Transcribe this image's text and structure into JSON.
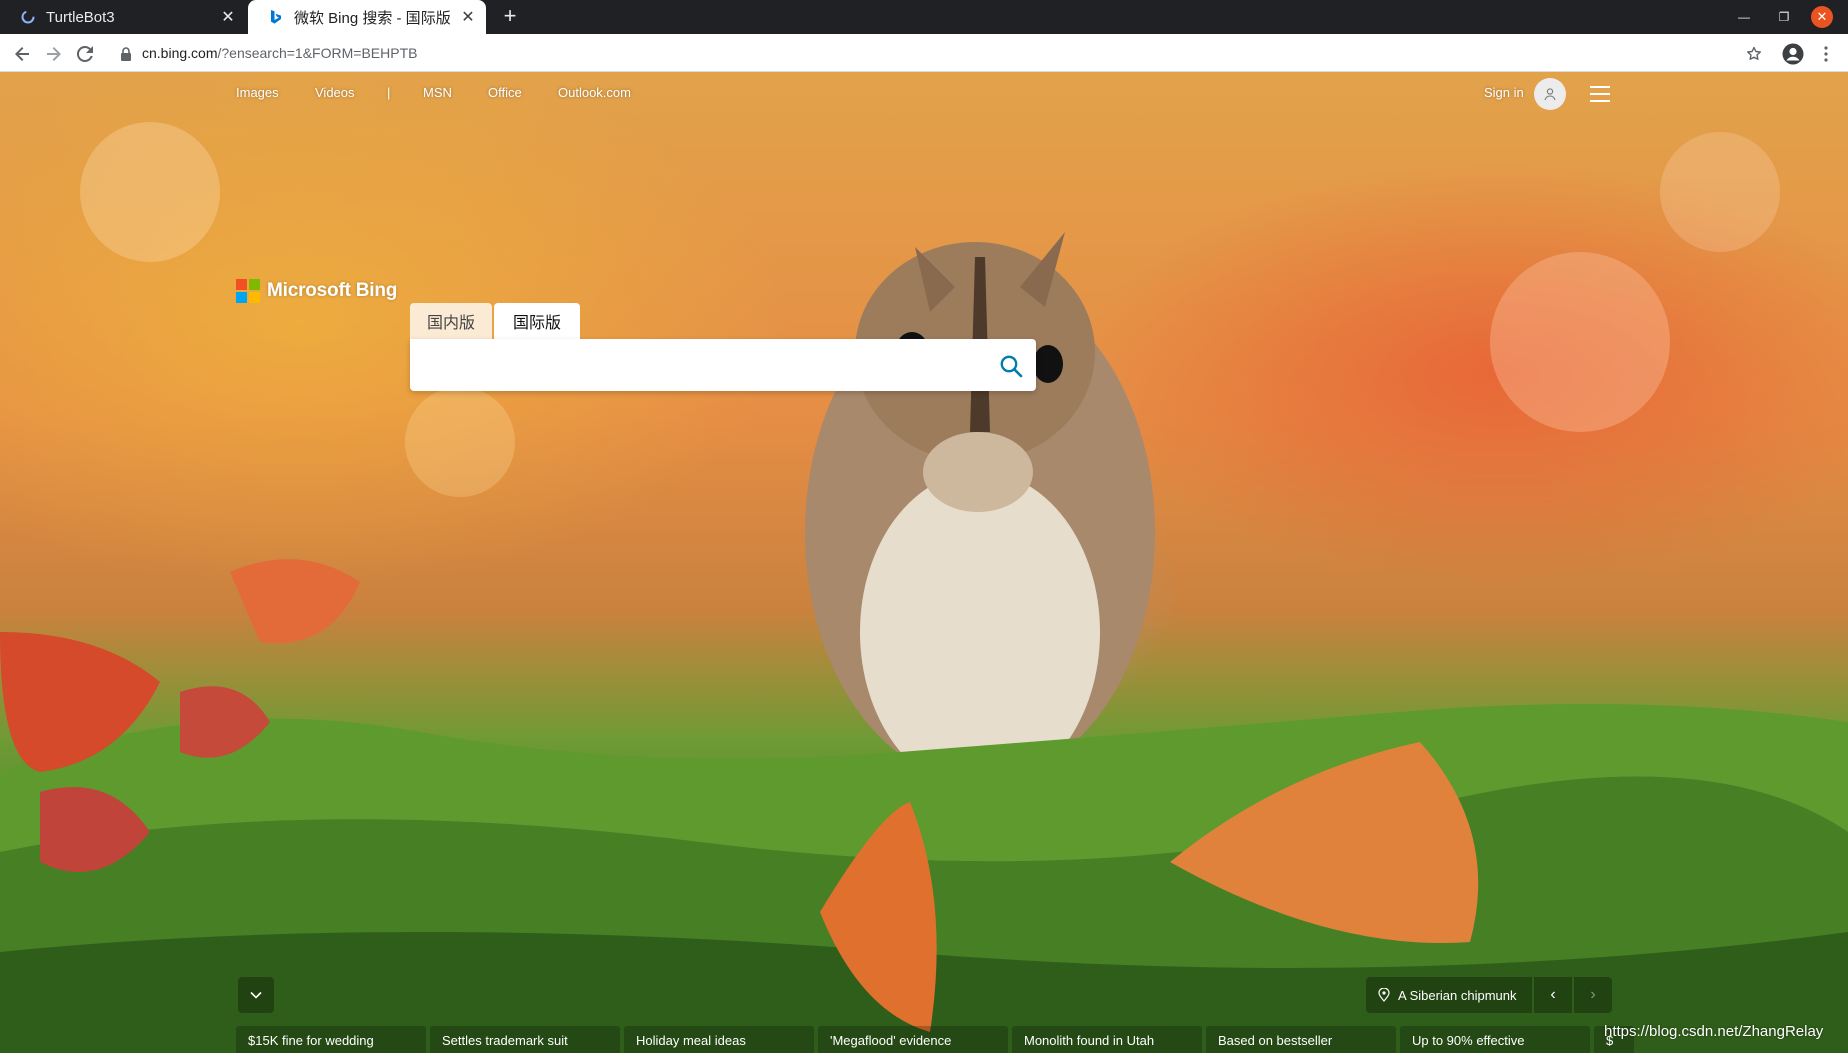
{
  "browser": {
    "tabs": [
      {
        "title": "TurtleBot3",
        "active": false,
        "icon": "loading-spinner-icon"
      },
      {
        "title": "微软 Bing 搜索 - 国际版",
        "active": true,
        "icon": "bing-favicon-icon"
      }
    ],
    "new_tab_label": "+",
    "url_host": "cn.bing.com",
    "url_path": "/?ensearch=1&FORM=BEHPTB"
  },
  "bing": {
    "nav": {
      "images": "Images",
      "videos": "Videos",
      "separator": "|",
      "msn": "MSN",
      "office": "Office",
      "outlook": "Outlook.com"
    },
    "sign_in": "Sign in",
    "logo_text": "Microsoft Bing",
    "logo_colors": [
      "#f25022",
      "#7fba00",
      "#00a4ef",
      "#ffb900"
    ],
    "search_tabs": {
      "domestic": "国内版",
      "international": "国际版"
    },
    "search_value": "",
    "search_icon_color": "#007daa",
    "image_caption": "A Siberian chipmunk",
    "news": [
      "$15K fine for wedding",
      "Settles trademark suit",
      "Holiday meal ideas",
      "'Megaflood' evidence",
      "Monolith found in Utah",
      "Based on bestseller",
      "Up to 90% effective",
      "$"
    ]
  },
  "overlay": {
    "watermark": "https://blog.csdn.net/ZhangRelay"
  }
}
